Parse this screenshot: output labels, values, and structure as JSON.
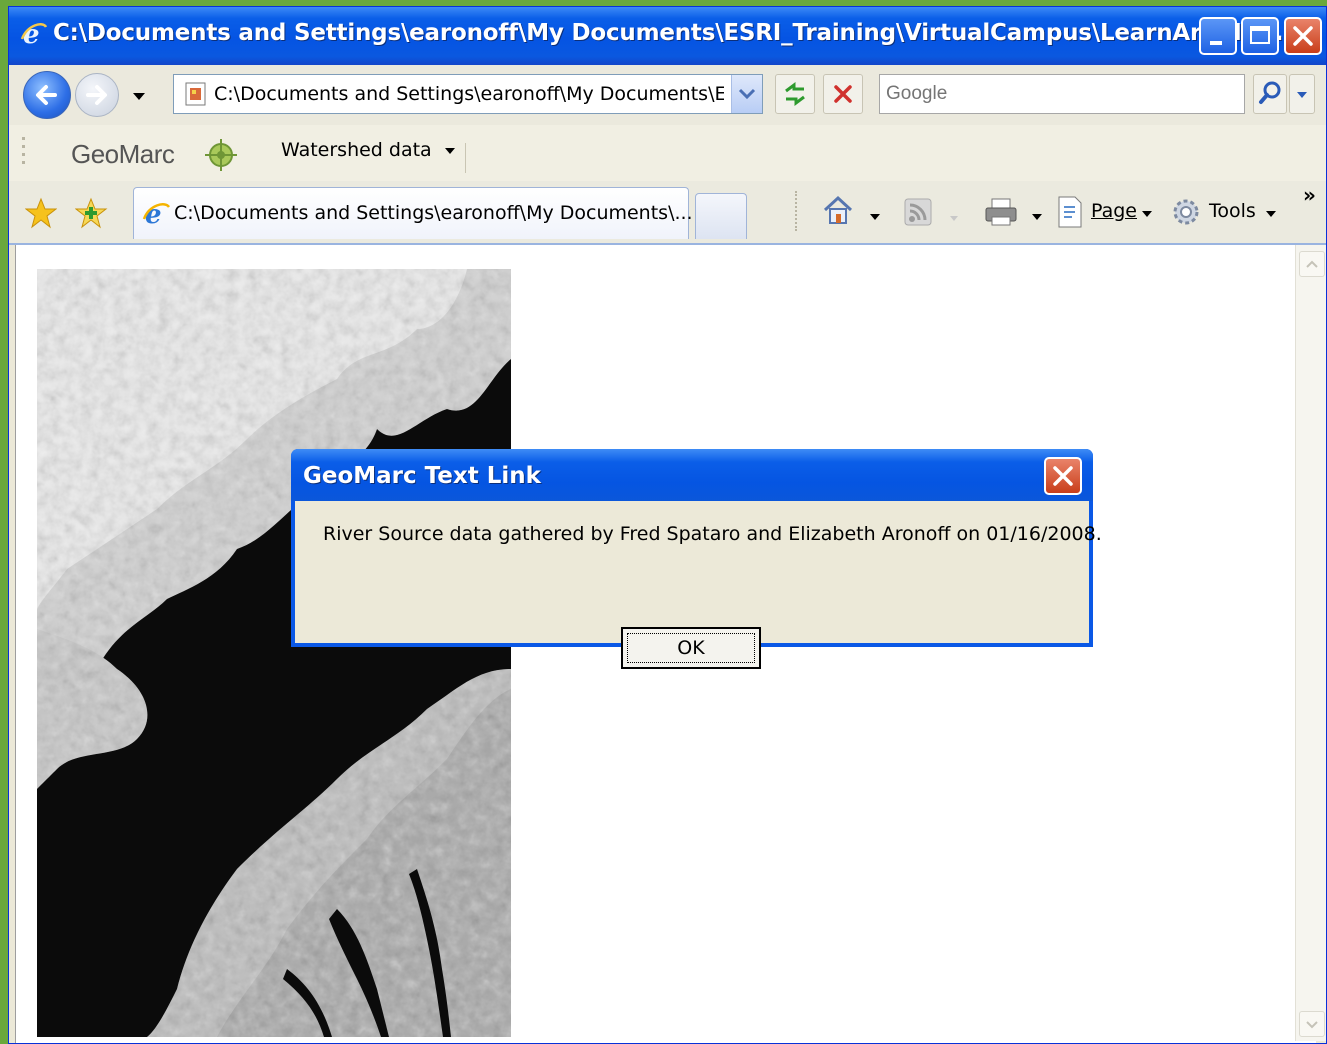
{
  "window": {
    "title": "C:\\Documents and Settings\\earonoff\\My Documents\\ESRI_Training\\VirtualCampus\\LearnArcGIS\\..."
  },
  "nav": {
    "address": "C:\\Documents and Settings\\earonoff\\My Documents\\ESRI",
    "search_placeholder": "Google"
  },
  "links_bar": {
    "brand": "GeoMarc",
    "dropdown_label": "Watershed data"
  },
  "tab": {
    "title": "C:\\Documents and Settings\\earonoff\\My Documents\\..."
  },
  "command_bar": {
    "page_label": "Page",
    "tools_label": "Tools",
    "overflow": "»"
  },
  "dialog": {
    "title": "GeoMarc Text Link",
    "message": "River Source data gathered by Fred Spataro and Elizabeth Aronoff on 01/16/2008.",
    "ok_label": "OK"
  },
  "colors": {
    "titlebar": "#0554e3",
    "window_face": "#ece9d8",
    "close_button": "#d9532e",
    "desktop_border": "#6aa83c"
  }
}
